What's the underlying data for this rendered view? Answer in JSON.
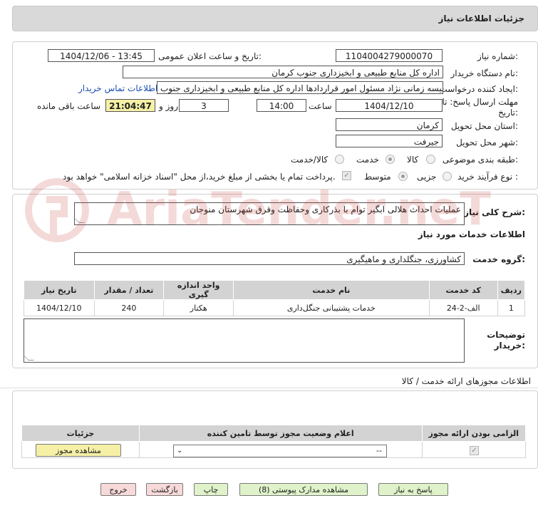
{
  "header": {
    "title": "جزئیات اطلاعات نیاز"
  },
  "form": {
    "need_number_label": "شماره نیاز:",
    "need_number": "1104004279000070",
    "announce_label": "تاریخ و ساعت اعلان عمومی:",
    "announce_value": "1404/12/06 - 13:45",
    "buyer_label": "نام دستگاه خریدار:",
    "buyer_value": "اداره کل منابع طبیعی و ابخیزداری جنوب کرمان",
    "creator_label": "ایجاد کننده درخواست:",
    "creator_value": "نفیسه زمانی نژاد مسئول امور قراردادها اداره کل منابع طبیعی و ابخیزداری جنوب",
    "contact_link": "اطلاعات تماس خریدار",
    "deadline_label_1": "مهلت ارسال پاسخ: تا",
    "deadline_label_2": "تاریخ:",
    "deadline_date": "1404/12/10",
    "time_label": "ساعت",
    "deadline_time": "14:00",
    "days_value": "3",
    "days_label": "روز و",
    "remaining_time": "21:04:47",
    "remaining_label": "ساعت باقی مانده",
    "province_label": "استان محل تحویل:",
    "province_value": "کرمان",
    "city_label": "شهر محل تحویل:",
    "city_value": "جیرفت",
    "category_label": "طبقه بندی موضوعی:",
    "category_options": [
      "کالا",
      "خدمت",
      "کالا/خدمت"
    ],
    "category_selected": "خدمت",
    "process_label": "نوع فرآیند خرید :",
    "process_options": [
      "جزیی",
      "متوسط"
    ],
    "process_selected": "متوسط",
    "payment_note": "پرداخت تمام یا بخشی از مبلغ خرید،از محل \"اسناد خزانه اسلامی\" خواهد بود."
  },
  "summary": {
    "label": "شرح کلی نیاز:",
    "value": "عملیات احداث هلالی ابگیر توام با بذرکاری وحفاظت وقرق شهرستان منوجان"
  },
  "services": {
    "title": "اطلاعات خدمات مورد نیاز",
    "group_label": "گروه خدمت:",
    "group_value": "کشاورزی، جنگلداری و ماهیگیری",
    "columns": [
      "ردیف",
      "کد خدمت",
      "نام خدمت",
      "واحد اندازه گیری",
      "تعداد / مقدار",
      "تاریخ نیاز"
    ],
    "rows": [
      [
        "1",
        "الف-2-24",
        "خدمات پشتیبانی جنگل‌داری",
        "هکتار",
        "240",
        "1404/12/10"
      ]
    ]
  },
  "buyer_notes": {
    "label_1": "توضیحات",
    "label_2": "خریدار:",
    "value": ""
  },
  "permits": {
    "section_title": "اطلاعات مجوزهای ارائه خدمت / کالا",
    "columns": [
      "الزامی بودن ارائه مجوز",
      "اعلام وضعیت مجوز توسط تامین کننده",
      "جزئیات"
    ],
    "select_value": "--",
    "view_button": "مشاهده مجوز"
  },
  "buttons": {
    "respond": "پاسخ به نیاز",
    "attachments": "مشاهده مدارک پیوستی (8)",
    "print": "چاپ",
    "back": "بازگشت",
    "exit": "خروج"
  },
  "watermark": {
    "text": "AriaTender.neT"
  },
  "colors": {
    "header_bg": "#d9d9d9",
    "button_green": "#dff2c9",
    "button_pink": "#f7d9d9",
    "highlight_yellow": "#f5f0a5",
    "link_blue": "#1a4fb0",
    "watermark_red": "#c0392b"
  }
}
